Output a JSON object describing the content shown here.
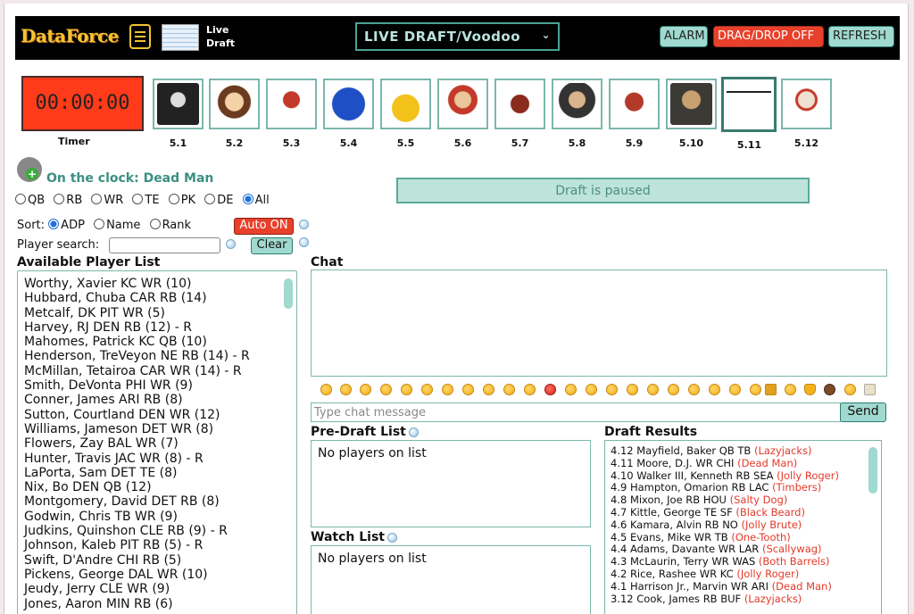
{
  "header": {
    "logo_text": "DataForce",
    "live_label_line1": "Live",
    "live_label_line2": "Draft",
    "draft_select": "LIVE DRAFT/Voodoo",
    "alarm": "ALARM",
    "dragdrop": "DRAG/DROP OFF",
    "refresh": "REFRESH"
  },
  "timer": {
    "value": "00:00:00",
    "label": "Timer"
  },
  "picks": [
    "5.1",
    "5.2",
    "5.3",
    "5.4",
    "5.5",
    "5.6",
    "5.7",
    "5.8",
    "5.9",
    "5.10",
    "5.11",
    "5.12"
  ],
  "on_clock": "On the clock: Dead Man",
  "status": "Draft is paused",
  "positions": [
    "QB",
    "RB",
    "WR",
    "TE",
    "PK",
    "DE",
    "All"
  ],
  "sort": {
    "label": "Sort:",
    "options": [
      "ADP",
      "Name",
      "Rank"
    ]
  },
  "auto": "Auto ON",
  "search": {
    "label": "Player search:",
    "clear": "Clear"
  },
  "available_title": "Available Player List",
  "players": [
    "Worthy, Xavier KC WR (10)",
    "Hubbard, Chuba CAR RB (14)",
    "Metcalf, DK PIT WR (5)",
    "Harvey, RJ DEN RB (12) - R",
    "Mahomes, Patrick KC QB (10)",
    "Henderson, TreVeyon NE RB (14) - R",
    "McMillan, Tetairoa CAR WR (14) - R",
    "Smith, DeVonta PHI WR (9)",
    "Conner, James ARI RB (8)",
    "Sutton, Courtland DEN WR (12)",
    "Williams, Jameson DET WR (8)",
    "Flowers, Zay BAL WR (7)",
    "Hunter, Travis JAC WR (8) - R",
    "LaPorta, Sam DET TE (8)",
    "Nix, Bo DEN QB (12)",
    "Montgomery, David DET RB (8)",
    "Godwin, Chris TB WR (9)",
    "Judkins, Quinshon CLE RB (9) - R",
    "Johnson, Kaleb PIT RB (5) - R",
    "Swift, D'Andre CHI RB (5)",
    "Pickens, George DAL WR (10)",
    "Jeudy, Jerry CLE WR (9)",
    "Jones, Aaron MIN RB (6)"
  ],
  "chat": {
    "title": "Chat",
    "placeholder": "Type chat message",
    "send": "Send"
  },
  "predraft": {
    "title": "Pre-Draft List",
    "empty": "No players on list"
  },
  "watch": {
    "title": "Watch List",
    "empty": "No players on list"
  },
  "draft_results_title": "Draft Results",
  "draft_results": [
    {
      "pick": "4.12 Mayfield, Baker QB TB",
      "team": "(Lazyjacks)"
    },
    {
      "pick": "4.11 Moore, D.J. WR CHI",
      "team": "(Dead Man)"
    },
    {
      "pick": "4.10 Walker III, Kenneth RB SEA",
      "team": "(Jolly Roger)"
    },
    {
      "pick": "4.9 Hampton, Omarion RB LAC",
      "team": "(Timbers)"
    },
    {
      "pick": "4.8 Mixon, Joe RB HOU",
      "team": "(Salty Dog)"
    },
    {
      "pick": "4.7 Kittle, George TE SF",
      "team": "(Black Beard)"
    },
    {
      "pick": "4.6 Kamara, Alvin RB NO",
      "team": "(Jolly Brute)"
    },
    {
      "pick": "4.5 Evans, Mike WR TB",
      "team": "(One-Tooth)"
    },
    {
      "pick": "4.4 Adams, Davante WR LAR",
      "team": "(Scallywag)"
    },
    {
      "pick": "4.3 McLaurin, Terry WR WAS",
      "team": "(Both Barrels)"
    },
    {
      "pick": "4.2 Rice, Rashee WR KC",
      "team": "(Jolly Roger)"
    },
    {
      "pick": "4.1 Harrison Jr., Marvin WR ARI",
      "team": "(Dead Man)"
    },
    {
      "pick": "3.12 Cook, James RB BUF",
      "team": "(Lazyjacks)"
    }
  ]
}
